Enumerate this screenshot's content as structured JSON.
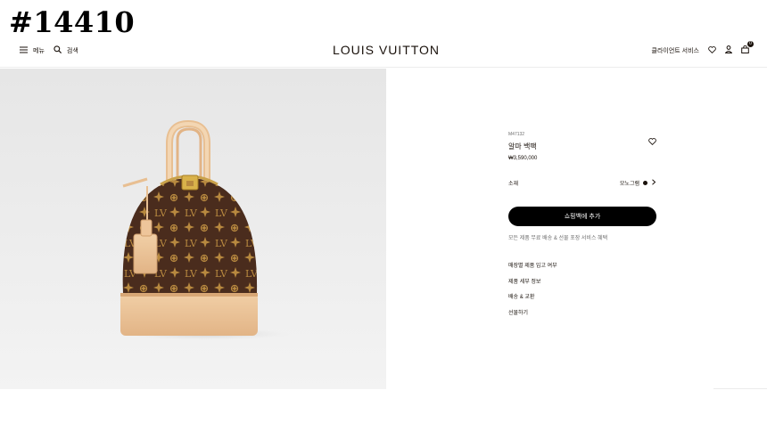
{
  "overlay": {
    "id_label": "#14410"
  },
  "header": {
    "menu_label": "메뉴",
    "search_label": "검색",
    "brand": "LOUIS VUITTON",
    "client_services": "클라이언트 서비스",
    "cart_count": "0"
  },
  "product": {
    "sku": "M47132",
    "name": "알마 백팩",
    "price": "₩3,590,000",
    "material_label": "소재",
    "material_value": "모노그램"
  },
  "actions": {
    "add_to_cart": "쇼핑백에 추가",
    "shipping_note": "모든 제품 무료 배송 & 선물 포장 서비스 혜택"
  },
  "links": [
    "매장별 제품 입고 여부",
    "제품 세부 정보",
    "배송 & 교환",
    "선물하기"
  ],
  "colors": {
    "text": "#19110b",
    "monogram_brown": "#4a2c1d",
    "monogram_gold": "#b8893f",
    "leather_trim": "#edc79c"
  },
  "icons": {
    "menu": "hamburger-icon",
    "search": "search-icon",
    "wishlist": "heart-icon",
    "account": "user-icon",
    "cart": "shopping-bag-icon",
    "chevron": "chevron-right-icon"
  }
}
